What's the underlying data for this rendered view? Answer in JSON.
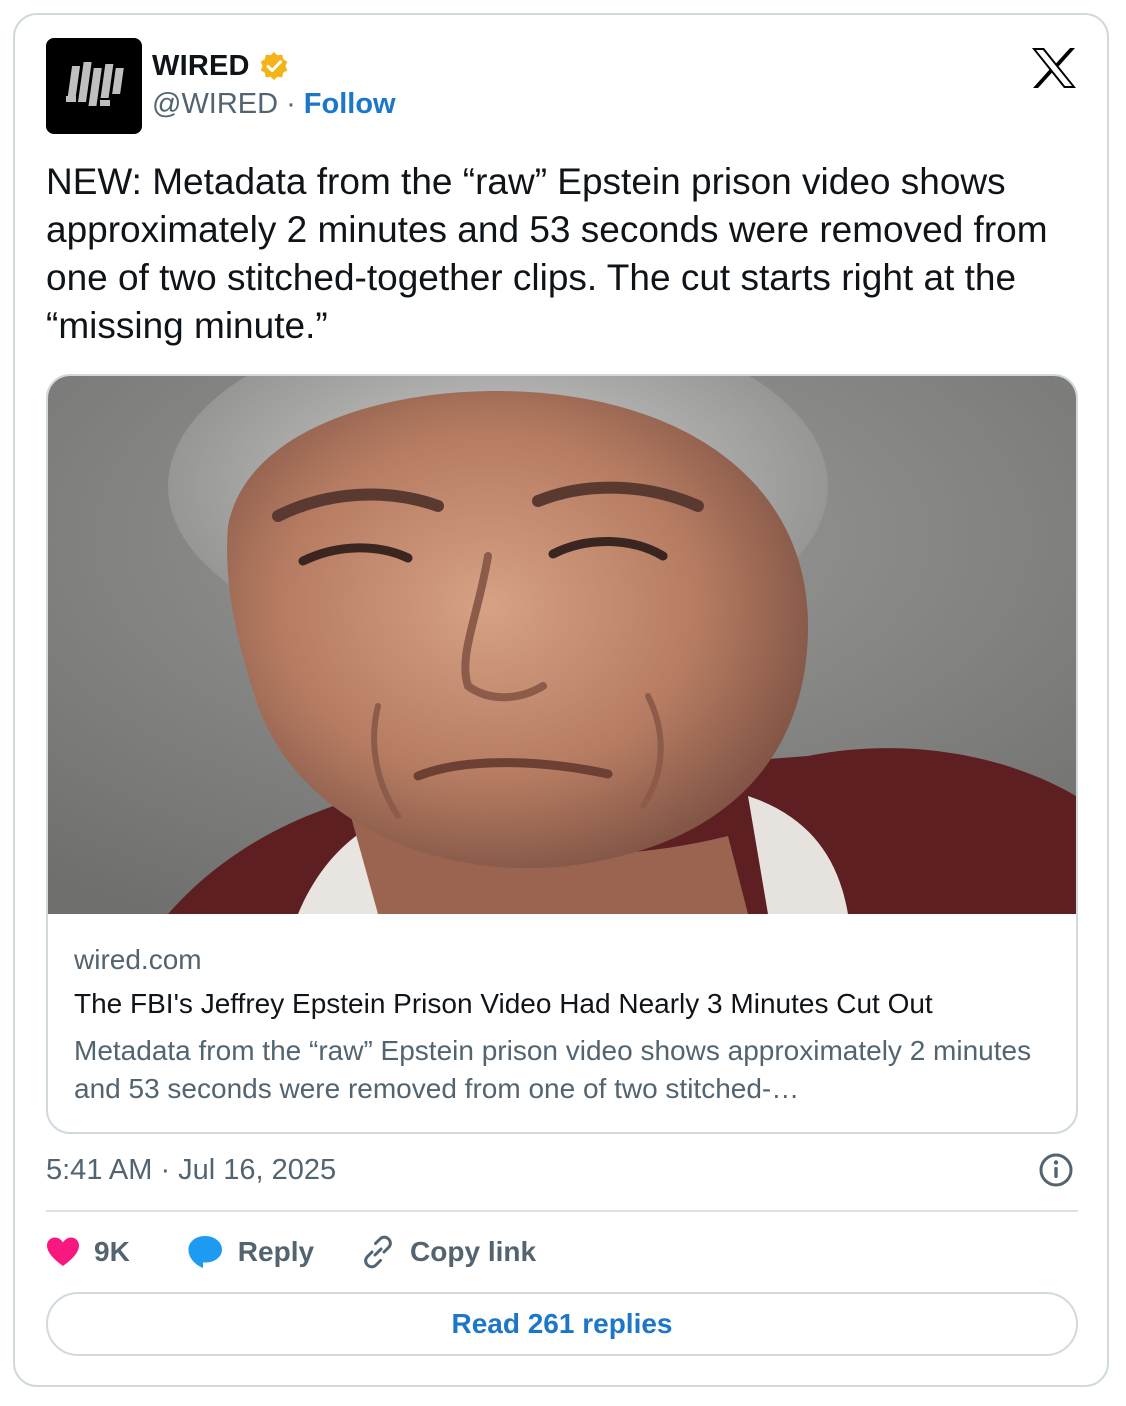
{
  "account": {
    "name": "WIRED",
    "handle": "@WIRED",
    "separator": "·",
    "follow_label": "Follow",
    "verified_color": "#f4b418",
    "logo_icon": "wired-logo-icon"
  },
  "tweet": {
    "text": "NEW: Metadata from the “raw” Epstein prison video shows approximately 2 minutes and 53 seconds were removed from one of two stitched-together clips. The cut starts right at the “missing minute.”",
    "timestamp": "5:41 AM · Jul 16, 2025"
  },
  "link_card": {
    "domain": "wired.com",
    "headline": "The FBI's Jeffrey Epstein Prison Video Had Nearly 3 Minutes Cut Out",
    "description": "Metadata from the “raw” Epstein prison video shows approximately 2 minutes and 53 seconds were removed from one of two stitched-…"
  },
  "actions": {
    "like_count": "9K",
    "reply_label": "Reply",
    "copy_link_label": "Copy link",
    "like_color": "#f91880",
    "reply_color": "#1d9bf0"
  },
  "read_replies_label": "Read 261 replies",
  "colors": {
    "link_blue": "#1d77c8",
    "secondary_text": "#536471",
    "border": "#cfd9de"
  }
}
